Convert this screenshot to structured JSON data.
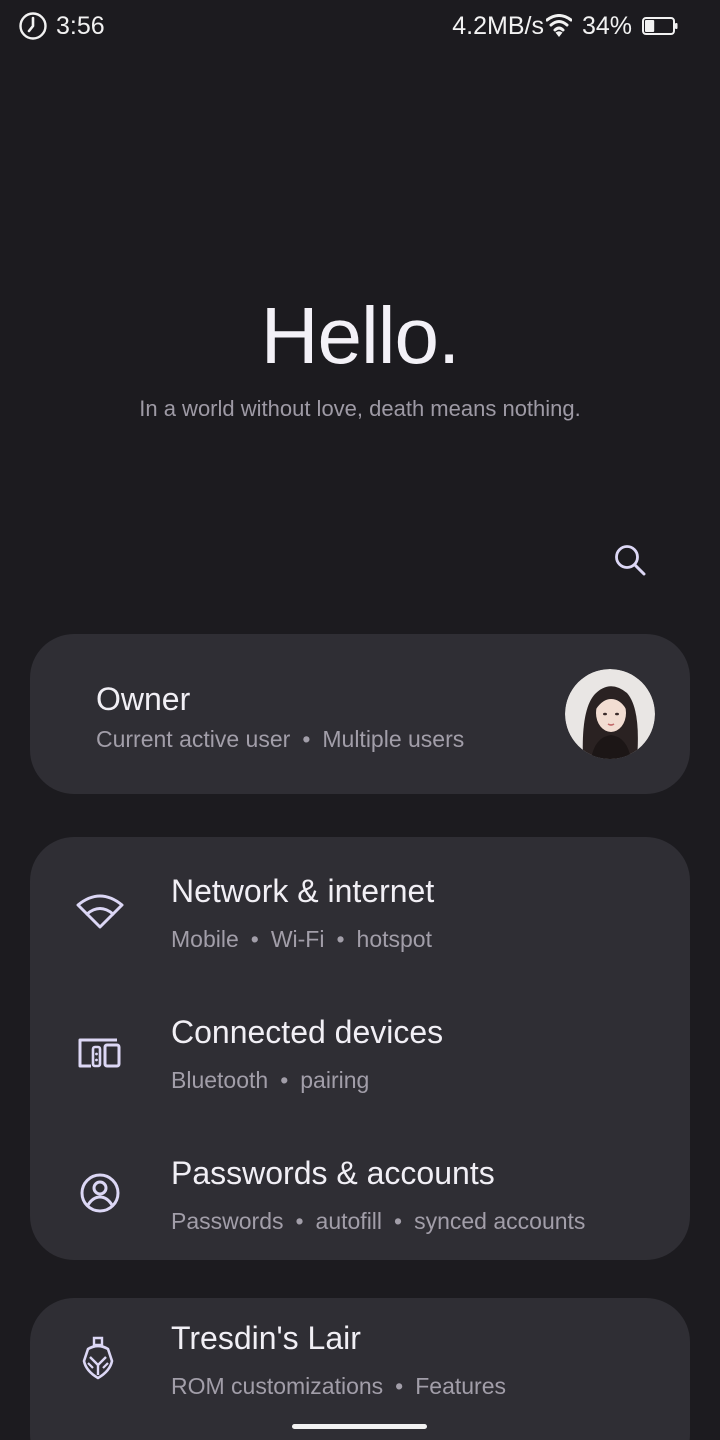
{
  "status_bar": {
    "time": "3:56",
    "net_speed": "4.2MB/s",
    "battery_percent": "34%",
    "battery_level": 0.34,
    "icons": [
      "alarm-icon",
      "wifi-icon",
      "battery-icon"
    ]
  },
  "header": {
    "greeting": "Hello.",
    "tagline": "In a world without love, death means nothing."
  },
  "search": {
    "icon": "search-icon"
  },
  "owner": {
    "title": "Owner",
    "subtitle_parts": [
      "Current active user",
      "Multiple users"
    ],
    "separator": "•",
    "avatar_icon": "user-avatar"
  },
  "settings": {
    "items": [
      {
        "title": "Network & internet",
        "subtitle_parts": [
          "Mobile",
          "Wi-Fi",
          "hotspot"
        ],
        "icon": "wifi-icon"
      },
      {
        "title": "Connected devices",
        "subtitle_parts": [
          "Bluetooth",
          "pairing"
        ],
        "icon": "devices-icon"
      },
      {
        "title": "Passwords & accounts",
        "subtitle_parts": [
          "Passwords",
          "autofill",
          "synced accounts"
        ],
        "icon": "account-circle-icon"
      }
    ]
  },
  "lair": {
    "title": "Tresdin's Lair",
    "subtitle_parts": [
      "ROM customizations",
      "Features"
    ],
    "icon": "helmet-icon"
  },
  "colors": {
    "background": "#1c1b1f",
    "card": "#2f2e34",
    "accent_icon": "#dcd7f5",
    "secondary_text": "#a29ea9"
  }
}
